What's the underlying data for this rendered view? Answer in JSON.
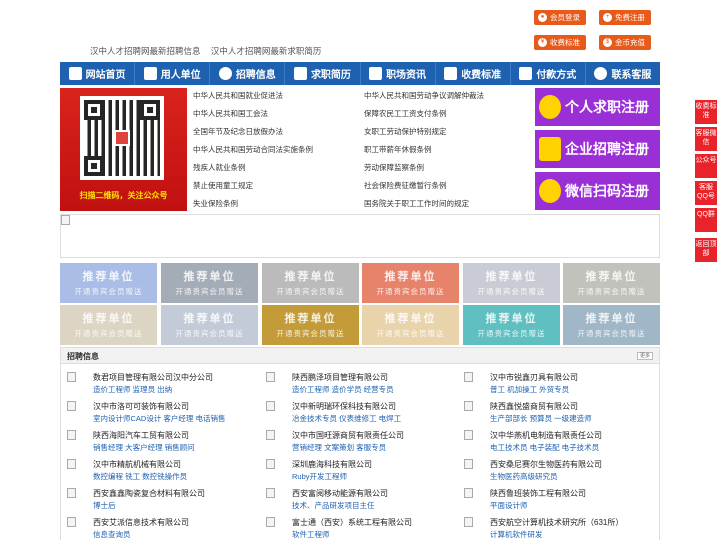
{
  "header": {
    "links": [
      "汉中人才招聘网最新招聘信息",
      "汉中人才招聘网最新求职简历"
    ],
    "buttons": [
      {
        "label": "会员登录",
        "icon": "user-icon"
      },
      {
        "label": "免费注册",
        "icon": "register-icon"
      },
      {
        "label": "收费标准",
        "icon": "fee-icon"
      },
      {
        "label": "金币充值",
        "icon": "coin-icon"
      }
    ]
  },
  "nav": [
    {
      "label": "网站首页",
      "icon": "home-icon"
    },
    {
      "label": "用人单位",
      "icon": "building-icon"
    },
    {
      "label": "招聘信息",
      "icon": "recruit-icon"
    },
    {
      "label": "求职简历",
      "icon": "resume-icon"
    },
    {
      "label": "职场资讯",
      "icon": "news-icon"
    },
    {
      "label": "收费标准",
      "icon": "fee-icon"
    },
    {
      "label": "付款方式",
      "icon": "payment-icon"
    },
    {
      "label": "联系客服",
      "icon": "phone-icon"
    }
  ],
  "qr_caption": "扫描二维码，关注公众号",
  "laws": {
    "left": [
      "中华人民共和国就业促进法",
      "中华人民共和国工会法",
      "全国年节及纪念日放假办法",
      "中华人民共和国劳动合同法实施条例",
      "残疾人就业条例",
      "禁止使用童工规定",
      "失业保险条例"
    ],
    "right": [
      "中华人民共和国劳动争议调解仲裁法",
      "保障农民工工资支付条例",
      "女职工劳动保护特别规定",
      "职工带薪年休假条例",
      "劳动保障监察条例",
      "社会保险费征缴暂行条例",
      "国务院关于职工工作时间的规定"
    ]
  },
  "register": [
    {
      "label": "个人求职注册",
      "icon": "person-icon"
    },
    {
      "label": "企业招聘注册",
      "icon": "company-icon"
    },
    {
      "label": "微信扫码注册",
      "icon": "wechat-icon"
    }
  ],
  "recommend": {
    "title": "推荐单位",
    "subtitle": "开通贵宾会员赠送",
    "colors": [
      "#a9bde6",
      "#a4acb8",
      "#bbbbbb",
      "#e8836b",
      "#c9ccd4",
      "#c2c2bd",
      "#ddd5c3",
      "#c3cbd8",
      "#c49b39",
      "#e9d3aa",
      "#5fbfc1",
      "#9fb7c7"
    ]
  },
  "jobs": {
    "title": "招聘信息",
    "more": "更多",
    "columns": [
      [
        {
          "name": "数君项目管理有限公司汉中分公司",
          "posts": "造价工程师 监理员 出纳"
        },
        {
          "name": "汉中市洛可可装饰有限公司",
          "posts": "室内设计师CAD设计 客户经理 电话销售"
        },
        {
          "name": "陕西海阳汽车工贸有限公司",
          "posts": "销售经理 大客户经理 销售顾问"
        },
        {
          "name": "汉中市精航机械有限公司",
          "posts": "数控编程 铣工 数控铣操作员"
        },
        {
          "name": "西安鑫鑫陶瓷复合材料有限公司",
          "posts": "博士后"
        },
        {
          "name": "西安艾派信息技术有限公司",
          "posts": "信息查询员"
        }
      ],
      [
        {
          "name": "陕西鹏泽项目管理有限公司",
          "posts": "造价工程师 造价学员 经营专员"
        },
        {
          "name": "汉中新明瑞环保科技有限公司",
          "posts": "冶金技术专员 仪表维修工 电焊工"
        },
        {
          "name": "汉中市国旺源商贸有限责任公司",
          "posts": "营销经理 文案策划 客服专员"
        },
        {
          "name": "深圳鹿海科技有限公司",
          "posts": "Ruby开发工程师"
        },
        {
          "name": "西安富阅移动能源有限公司",
          "posts": "技术、产品研发项目主任"
        },
        {
          "name": "富士通（西安）系统工程有限公司",
          "posts": "软件工程师"
        }
      ],
      [
        {
          "name": "汉中市锐鑫刃具有限公司",
          "posts": "普工 机加操工 外贸专员"
        },
        {
          "name": "陕西鑫悦盛商贸有限公司",
          "posts": "生产部部长 预算员 一级建造师"
        },
        {
          "name": "汉中华燕机电制造有限责任公司",
          "posts": "电工技术员 电子装配 电子技术员"
        },
        {
          "name": "西安桑尼赛尔生物医药有限公司",
          "posts": "生物医药高级研究员"
        },
        {
          "name": "陕西鲁班装饰工程有限公司",
          "posts": "平面设计师"
        },
        {
          "name": "西安航空计算机技术研究所（631所）",
          "posts": "计算机软件研发"
        }
      ]
    ]
  },
  "float": [
    {
      "label": "收费标准"
    },
    {
      "label": "客服微信"
    },
    {
      "label": "公众号"
    },
    {
      "label": "客服QQ号"
    },
    {
      "label": "QQ群"
    },
    {
      "label": "返回顶部"
    }
  ]
}
